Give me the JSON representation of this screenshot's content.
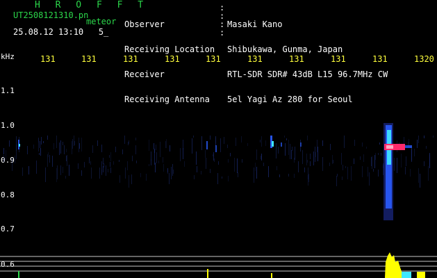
{
  "header": {
    "title": "H R O F F T",
    "file_name": "UT2508121310.pn",
    "mode": "meteor",
    "date_time": "25.08.12 13:10   5_",
    "info": [
      {
        "label": "Observer",
        "value": "Masaki Kano"
      },
      {
        "label": "Receiving Location",
        "value": "Shibukawa, Gunma, Japan"
      },
      {
        "label": "Receiver",
        "value": "RTL-SDR SDR# 43dB L15 96.7MHz CW"
      },
      {
        "label": "Receiving Antenna",
        "value": "5el Yagi Az 280 for Seoul"
      }
    ]
  },
  "axis": {
    "y_unit": "kHz",
    "y_ticks": [
      "1.1",
      "1.0",
      "0.9",
      "0.8",
      "0.7",
      "0.6"
    ],
    "x_ticks": [
      "131",
      "131",
      "131",
      "131",
      "131",
      "131",
      "131",
      "131",
      "131",
      "1320"
    ]
  },
  "colors": {
    "header_green": "#2bd64a",
    "tick_yellow": "#ffff3c",
    "background": "#000000",
    "echo_red": "#ff2a6a",
    "echo_cyan": "#3fe8ff",
    "echo_blue": "#2a5cff",
    "power_yellow": "#ffff00"
  }
}
